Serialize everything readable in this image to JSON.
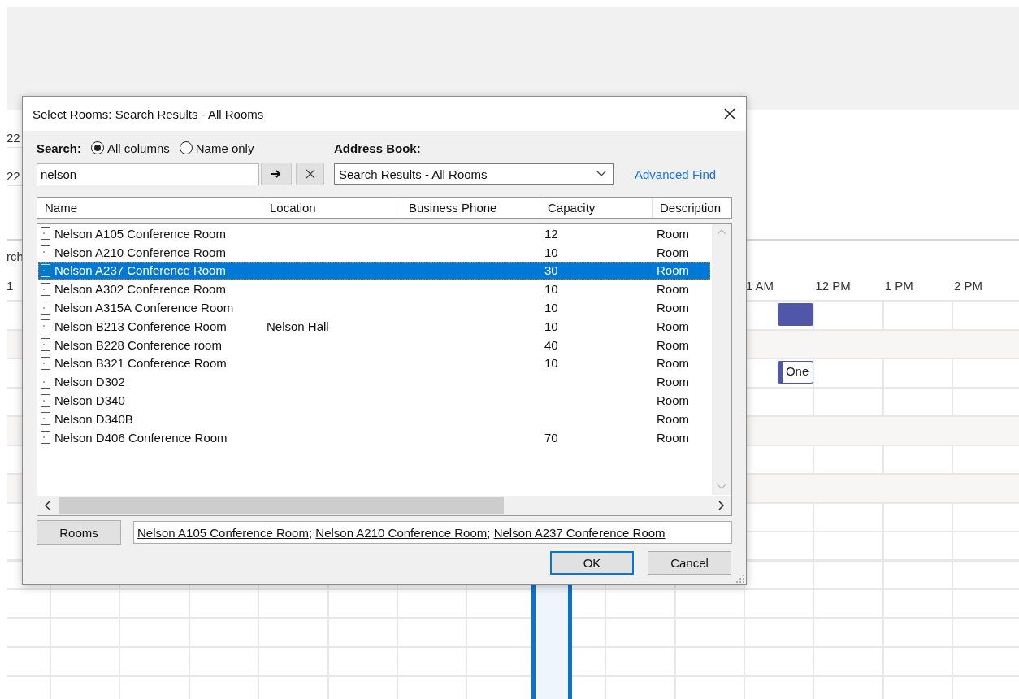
{
  "schedule": {
    "upper_rows": [
      "22",
      "22"
    ],
    "side_labels": [
      "rch",
      "1"
    ],
    "time_labels": [
      "1 AM",
      "12 PM",
      "1 PM",
      "2 PM"
    ],
    "events": [
      {
        "kind": "busy"
      },
      {
        "kind": "labeled",
        "text": "One"
      }
    ]
  },
  "dialog": {
    "title": "Select Rooms: Search Results - All Rooms",
    "search_label": "Search:",
    "search_modes": [
      {
        "label": "All columns",
        "selected": true
      },
      {
        "label": "Name only",
        "selected": false
      }
    ],
    "search_field": {
      "value": "nelson"
    },
    "address_book_label": "Address Book:",
    "address_book": {
      "value": "Search Results - All Rooms"
    },
    "advanced_find": "Advanced Find",
    "table": {
      "columns": [
        "Name",
        "Location",
        "Business Phone",
        "Capacity",
        "Description"
      ],
      "rows": [
        {
          "name": "Nelson A105 Conference Room",
          "capacity": "12",
          "description": "Room",
          "selected": false
        },
        {
          "name": "Nelson A210 Conference Room",
          "capacity": "10",
          "description": "Room",
          "selected": false
        },
        {
          "name": "Nelson A237 Conference Room",
          "capacity": "30",
          "description": "Room",
          "selected": true
        },
        {
          "name": "Nelson A302 Conference Room",
          "capacity": "10",
          "description": "Room",
          "selected": false
        },
        {
          "name": "Nelson A315A Conference Room",
          "capacity": "10",
          "description": "Room",
          "selected": false
        },
        {
          "name": "Nelson B213 Conference Room",
          "location": "Nelson Hall",
          "capacity": "10",
          "description": "Room",
          "selected": false
        },
        {
          "name": "Nelson B228 Conference room",
          "capacity": "40",
          "description": "Room",
          "selected": false
        },
        {
          "name": "Nelson B321 Conference Room",
          "capacity": "10",
          "description": "Room",
          "selected": false
        },
        {
          "name": "Nelson D302",
          "description": "Room",
          "selected": false
        },
        {
          "name": "Nelson D340",
          "description": "Room",
          "selected": false
        },
        {
          "name": "Nelson D340B",
          "description": "Room",
          "selected": false
        },
        {
          "name": "Nelson D406 Conference Room",
          "capacity": "70",
          "description": "Room",
          "selected": false
        }
      ]
    },
    "rooms_button": "Rooms",
    "selected_rooms": [
      "Nelson A105 Conference Room",
      "Nelson A210 Conference Room",
      "Nelson A237 Conference Room"
    ],
    "separator": ";",
    "buttons": [
      {
        "label": "OK",
        "default": true
      },
      {
        "label": "Cancel",
        "default": false
      }
    ]
  }
}
